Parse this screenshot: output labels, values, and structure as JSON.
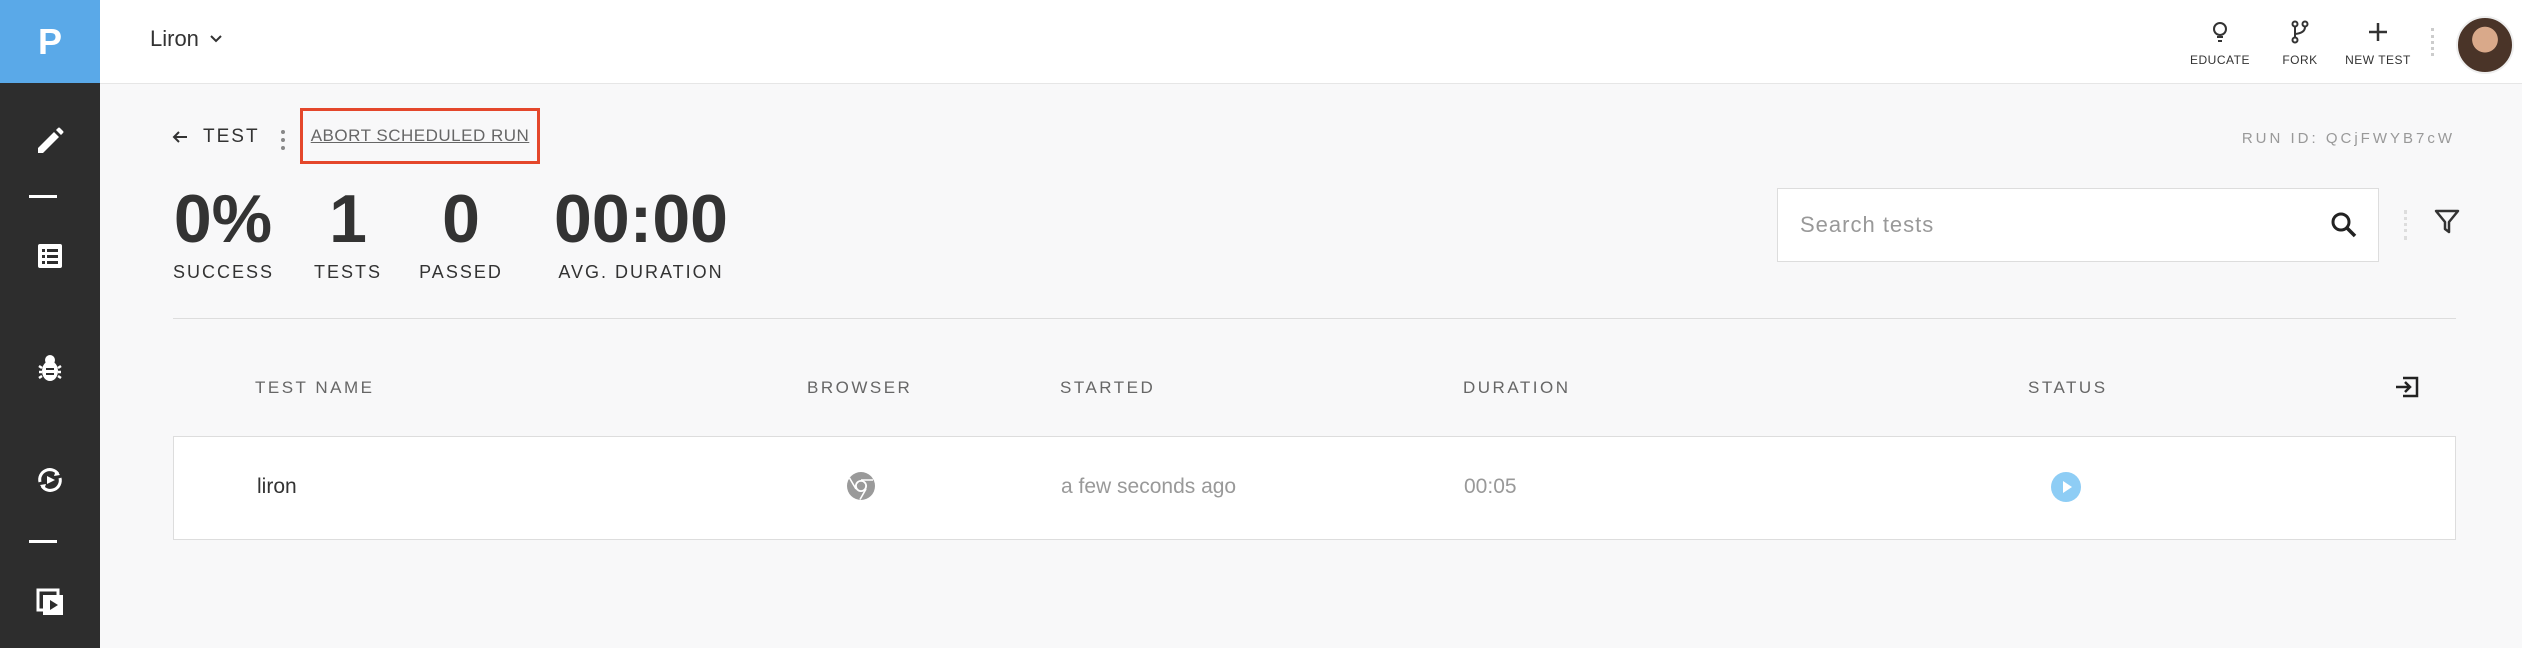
{
  "sidebar": {
    "logo": "P",
    "items": [
      "edit-icon",
      "list-icon",
      "bug-icon",
      "runs-icon",
      "play-collection-icon"
    ]
  },
  "topbar": {
    "project": "Liron",
    "educate_label": "EDUCATE",
    "fork_label": "FORK",
    "new_test_label": "NEW TEST"
  },
  "header": {
    "title": "TEST",
    "abort_label": "ABORT SCHEDULED RUN",
    "run_id": "RUN ID: QCjFWYB7cW"
  },
  "stats": [
    {
      "value": "0%",
      "caption": "SUCCESS"
    },
    {
      "value": "1",
      "caption": "TESTS"
    },
    {
      "value": "0",
      "caption": "PASSED"
    },
    {
      "value": "00:00",
      "caption": "AVG. DURATION"
    }
  ],
  "search": {
    "placeholder": "Search tests",
    "value": ""
  },
  "table": {
    "columns": [
      "TEST NAME",
      "BROWSER",
      "STARTED",
      "DURATION",
      "STATUS"
    ],
    "rows": [
      {
        "name": "liron",
        "browser": "chrome-icon",
        "started": "a few seconds ago",
        "duration": "00:05",
        "status": "running"
      }
    ]
  },
  "colors": {
    "accent": "#5aa9e8",
    "sidebar": "#2d2d2d",
    "highlight": "#e4472b",
    "status_running": "#8ecdf5"
  }
}
